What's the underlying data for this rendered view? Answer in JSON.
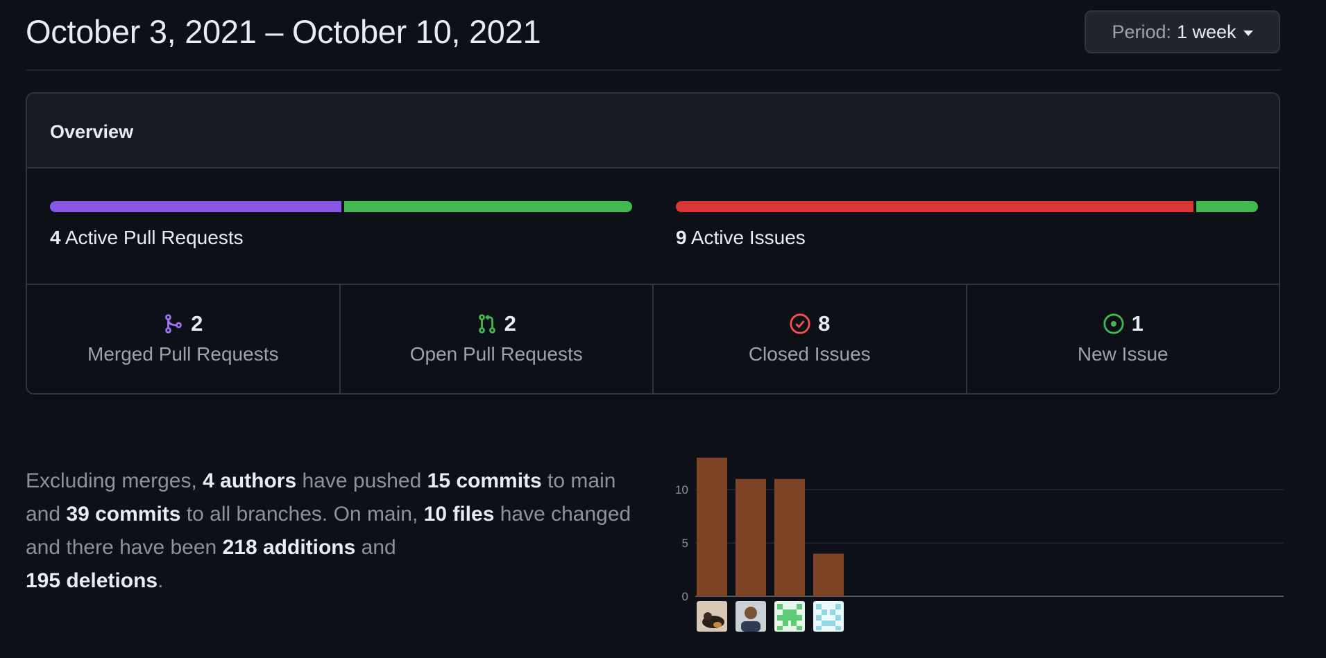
{
  "header": {
    "title": "October 3, 2021 – October 10, 2021",
    "period_label": "Period:",
    "period_value": "1 week"
  },
  "overview": {
    "heading": "Overview",
    "pull_requests": {
      "count": "4",
      "label": "Active Pull Requests",
      "merged_fraction": 0.5
    },
    "issues": {
      "count": "9",
      "label": "Active Issues",
      "closed_fraction": 0.889
    },
    "stats": [
      {
        "icon": "merge-icon",
        "value": "2",
        "label": "Merged Pull Requests",
        "color": "#a371f7"
      },
      {
        "icon": "pull-request-icon",
        "value": "2",
        "label": "Open Pull Requests",
        "color": "#3fb950"
      },
      {
        "icon": "issue-closed-icon",
        "value": "8",
        "label": "Closed Issues",
        "color": "#f85149"
      },
      {
        "icon": "issue-opened-icon",
        "value": "1",
        "label": "New Issue",
        "color": "#3fb950"
      }
    ],
    "colors": {
      "merged": "#8957e5",
      "open": "#3fb950",
      "closed": "#da3633",
      "new": "#3fb950"
    }
  },
  "summary": {
    "p1": "Excluding merges, ",
    "authors": "4 authors",
    "p2": " have pushed ",
    "commits_main": "15 commits",
    "p3": " to main and ",
    "commits_all": "39 commits",
    "p4": " to all branches. On main, ",
    "files": "10 files",
    "p5": " have changed and there have been ",
    "additions_num": "218",
    "additions_word": "additions",
    "p6": " and ",
    "deletions_num": "195",
    "deletions_word": "deletions",
    "p7": "."
  },
  "chart_data": {
    "type": "bar",
    "categories": [
      "author-1",
      "author-2",
      "author-3",
      "author-4"
    ],
    "values": [
      13,
      11,
      11,
      4
    ],
    "yticks": [
      "0",
      "5",
      "10"
    ],
    "ylim": [
      0,
      13
    ],
    "bar_color": "#7d4325",
    "grid": true
  }
}
